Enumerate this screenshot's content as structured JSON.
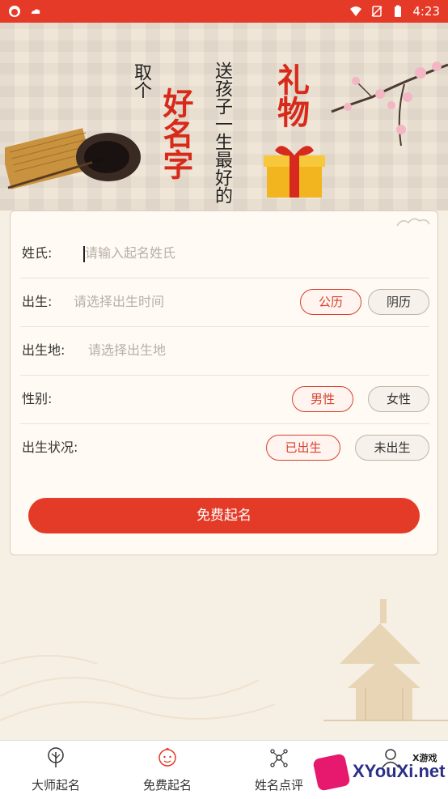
{
  "statusbar": {
    "time": "4:23"
  },
  "banner": {
    "line1": "取个",
    "line2": "好名字",
    "line3": "送孩子一生最好的",
    "line4": "礼物"
  },
  "form": {
    "surname": {
      "label": "姓氏:",
      "placeholder": "请输入起名姓氏"
    },
    "birth": {
      "label": "出生:",
      "placeholder": "请选择出生时间",
      "options": [
        "公历",
        "阴历"
      ],
      "selected": "公历"
    },
    "birthplace": {
      "label": "出生地:",
      "placeholder": "请选择出生地"
    },
    "gender": {
      "label": "性别:",
      "options": [
        "男性",
        "女性"
      ],
      "selected": "男性"
    },
    "birth_status": {
      "label": "出生状况:",
      "options": [
        "已出生",
        "未出生"
      ],
      "selected": "已出生"
    },
    "submit_label": "免费起名"
  },
  "nav": {
    "items": [
      {
        "label": "大师起名",
        "icon": "tree-icon"
      },
      {
        "label": "免费起名",
        "icon": "baby-icon"
      },
      {
        "label": "姓名点评",
        "icon": "network-icon"
      },
      {
        "label": "",
        "icon": "person-icon"
      }
    ],
    "active_index": 1
  },
  "watermark": {
    "text": "XYouXi.net",
    "small": "X游戏"
  },
  "colors": {
    "accent": "#e33b27",
    "active_pill": "#d8412e"
  }
}
